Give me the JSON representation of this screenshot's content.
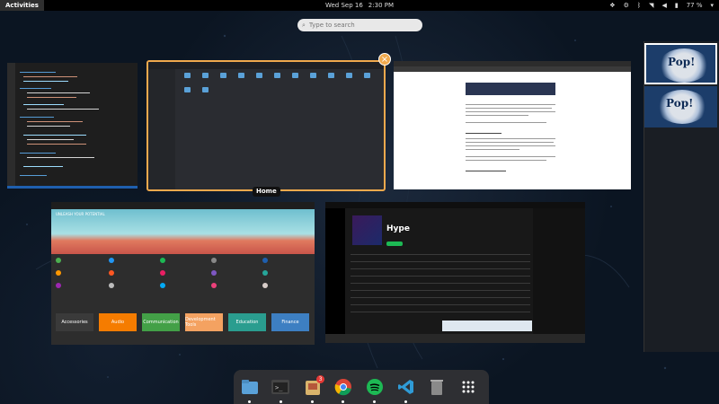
{
  "topbar": {
    "activities": "Activities",
    "date": "Wed Sep 16",
    "time": "2:30 PM",
    "battery": "77 %",
    "tray_icons": [
      "dropbox-icon",
      "settings-icon",
      "bluetooth-icon",
      "wifi-icon",
      "volume-icon",
      "battery-icon"
    ]
  },
  "search": {
    "placeholder": "Type to search"
  },
  "overview": {
    "hover_label": "Home",
    "windows": [
      {
        "app": "Visual Studio Code"
      },
      {
        "app": "Files"
      },
      {
        "app": "Google Chrome"
      },
      {
        "app": "Pop!_Shop"
      },
      {
        "app": "Spotify",
        "playlist": "Hype"
      }
    ],
    "software_categories": [
      "Accessories",
      "Audio",
      "Communication",
      "Development Tools",
      "Education",
      "Finance"
    ],
    "software_hero": "UNLEASH YOUR POTENTIAL"
  },
  "workspaces": [
    {
      "label": "Pop!",
      "active": true
    },
    {
      "label": "Pop!",
      "active": false
    }
  ],
  "dash": {
    "items": [
      "files-icon",
      "terminal-icon",
      "software-center-icon",
      "chrome-icon",
      "spotify-icon",
      "vscode-icon",
      "trash-icon",
      "app-grid-icon"
    ],
    "badge": "3"
  },
  "colors": {
    "accent": "#f0a94d",
    "spotify_green": "#1db954",
    "vscode_blue": "#1f5fae"
  }
}
